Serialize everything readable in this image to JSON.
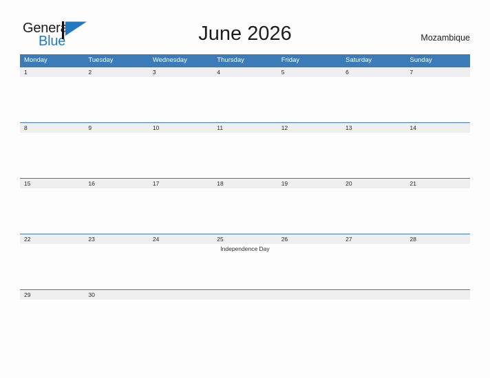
{
  "brand": {
    "name_part1": "General",
    "name_part2": "Blue",
    "flag_icon": "flag-icon",
    "color_blue": "#1f7ac0",
    "color_dark": "#1a1a1a"
  },
  "header": {
    "title": "June 2026",
    "country": "Mozambique",
    "header_bg": "#3b7cb8",
    "band_bg": "#efefef"
  },
  "weekdays": [
    "Monday",
    "Tuesday",
    "Wednesday",
    "Thursday",
    "Friday",
    "Saturday",
    "Sunday"
  ],
  "weeks": [
    {
      "days": [
        {
          "num": "1",
          "event": ""
        },
        {
          "num": "2",
          "event": ""
        },
        {
          "num": "3",
          "event": ""
        },
        {
          "num": "4",
          "event": ""
        },
        {
          "num": "5",
          "event": ""
        },
        {
          "num": "6",
          "event": ""
        },
        {
          "num": "7",
          "event": ""
        }
      ]
    },
    {
      "days": [
        {
          "num": "8",
          "event": ""
        },
        {
          "num": "9",
          "event": ""
        },
        {
          "num": "10",
          "event": ""
        },
        {
          "num": "11",
          "event": ""
        },
        {
          "num": "12",
          "event": ""
        },
        {
          "num": "13",
          "event": ""
        },
        {
          "num": "14",
          "event": ""
        }
      ]
    },
    {
      "days": [
        {
          "num": "15",
          "event": ""
        },
        {
          "num": "16",
          "event": ""
        },
        {
          "num": "17",
          "event": ""
        },
        {
          "num": "18",
          "event": ""
        },
        {
          "num": "19",
          "event": ""
        },
        {
          "num": "20",
          "event": ""
        },
        {
          "num": "21",
          "event": ""
        }
      ]
    },
    {
      "days": [
        {
          "num": "22",
          "event": ""
        },
        {
          "num": "23",
          "event": ""
        },
        {
          "num": "24",
          "event": ""
        },
        {
          "num": "25",
          "event": "Independence Day"
        },
        {
          "num": "26",
          "event": ""
        },
        {
          "num": "27",
          "event": ""
        },
        {
          "num": "28",
          "event": ""
        }
      ]
    },
    {
      "days": [
        {
          "num": "29",
          "event": ""
        },
        {
          "num": "30",
          "event": ""
        },
        {
          "num": "",
          "event": ""
        },
        {
          "num": "",
          "event": ""
        },
        {
          "num": "",
          "event": ""
        },
        {
          "num": "",
          "event": ""
        },
        {
          "num": "",
          "event": ""
        }
      ]
    }
  ]
}
